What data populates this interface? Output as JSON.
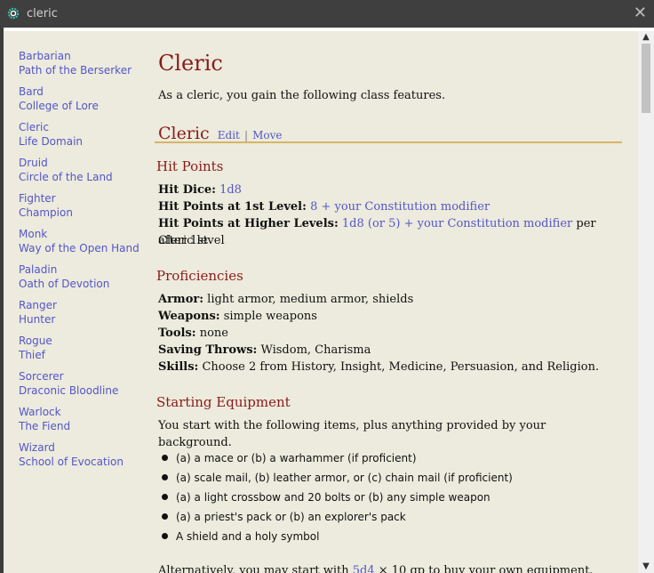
{
  "window": {
    "title": "cleric",
    "close_glyph": "✕",
    "icon": "gear-icon"
  },
  "sidebar": {
    "groups": [
      {
        "class": "Barbarian",
        "sub": "Path of the Berserker"
      },
      {
        "class": "Bard",
        "sub": "College of Lore"
      },
      {
        "class": "Cleric",
        "sub": "Life Domain"
      },
      {
        "class": "Druid",
        "sub": "Circle of the Land"
      },
      {
        "class": "Fighter",
        "sub": "Champion"
      },
      {
        "class": "Monk",
        "sub": "Way of the Open Hand"
      },
      {
        "class": "Paladin",
        "sub": "Oath of Devotion"
      },
      {
        "class": "Ranger",
        "sub": "Hunter"
      },
      {
        "class": "Rogue",
        "sub": "Thief"
      },
      {
        "class": "Sorcerer",
        "sub": "Draconic Bloodline"
      },
      {
        "class": "Warlock",
        "sub": "The Fiend"
      },
      {
        "class": "Wizard",
        "sub": "School of Evocation"
      }
    ]
  },
  "main": {
    "title": "Cleric",
    "intro": "As a cleric, you gain the following class features.",
    "section_title": "Cleric",
    "edit_label": "Edit",
    "sep": "|",
    "move_label": "Move",
    "hit_points": {
      "heading": "Hit Points",
      "dice_label": "Hit Dice:",
      "dice_value": "1d8",
      "first_label": "Hit Points at 1st Level:",
      "first_value": "8 + your Constitution modifier",
      "higher_label": "Hit Points at Higher Levels:",
      "higher_value": "1d8 (or 5) + your Constitution modifier",
      "higher_suffix": "per Cleric level",
      "higher_line2": "after 1st"
    },
    "proficiencies": {
      "heading": "Proficiencies",
      "armor_label": "Armor:",
      "armor_value": "light armor, medium armor, shields",
      "weapons_label": "Weapons:",
      "weapons_value": "simple weapons",
      "tools_label": "Tools:",
      "tools_value": "none",
      "saves_label": "Saving Throws:",
      "saves_value": "Wisdom, Charisma",
      "skills_label": "Skills:",
      "skills_value": "Choose 2 from History, Insight, Medicine, Persuasion, and Religion."
    },
    "equipment": {
      "heading": "Starting Equipment",
      "intro": "You start with the following items, plus anything provided by your background.",
      "items": [
        "(a) a mace or (b) a warhammer (if proficient)",
        "(a) scale mail, (b) leather armor, or (c) chain mail (if proficient)",
        "(a) a light crossbow and 20 bolts or (b) any simple weapon",
        "(a) a priest's pack or (b) an explorer's pack",
        "A shield and a holy symbol"
      ],
      "alt_prefix": "Alternatively, you may start with",
      "alt_link": "5d4",
      "alt_suffix": "× 10 gp to buy your own equipment."
    }
  },
  "scrollbar": {
    "up_glyph": "▲",
    "down_glyph": "▼"
  }
}
